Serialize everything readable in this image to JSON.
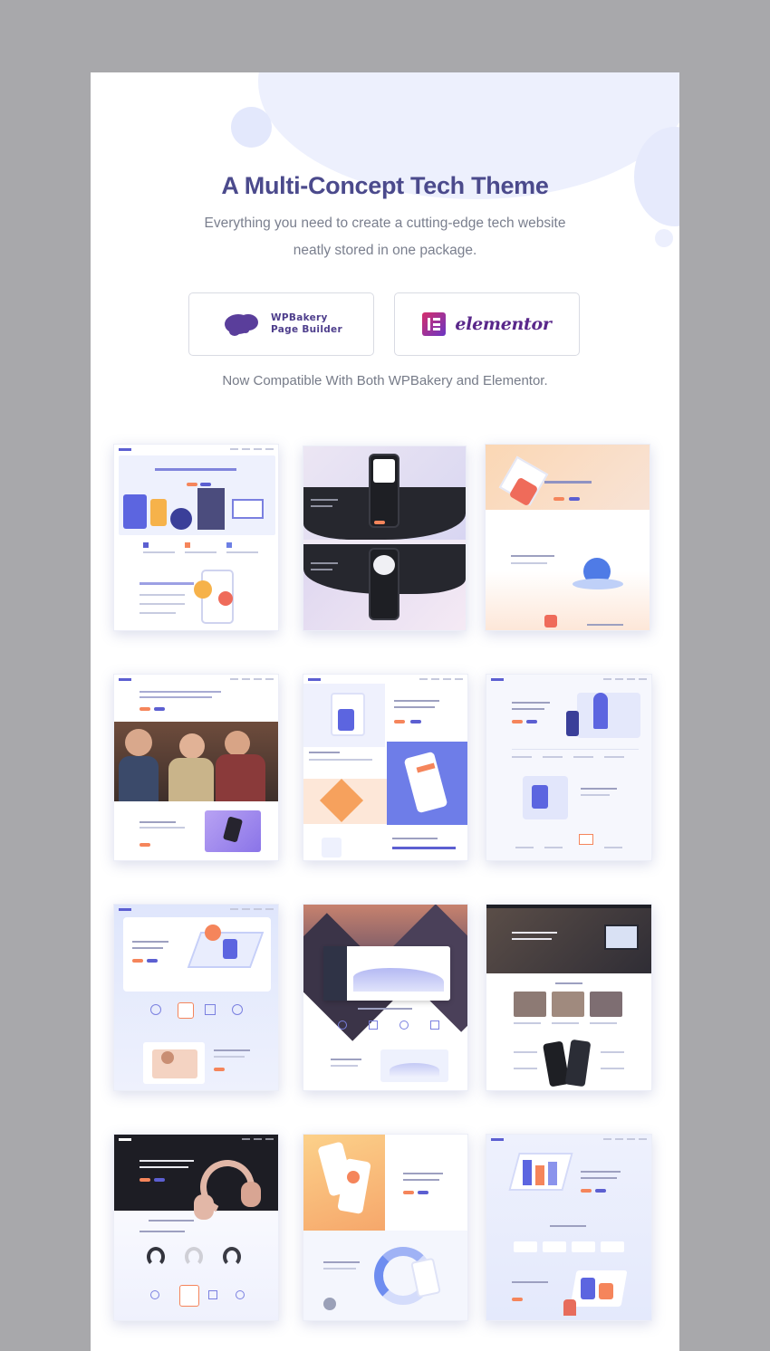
{
  "hero": {
    "title": "A Multi-Concept Tech Theme",
    "subtitle_line1": "Everything you need to create a cutting-edge tech website",
    "subtitle_line2": "neatly stored in one package."
  },
  "builders": {
    "wpbakery_label": "WPBakery\nPage Builder",
    "elementor_label": "elementor"
  },
  "compat_text": "Now Compatible With Both WPBakery and Elementor.",
  "colors": {
    "accent": "#4b4a8c",
    "brand_purple": "#5c5fd1",
    "cta_orange": "#f5855b",
    "elementor_gradient": "#d62e6b"
  },
  "thumbnails": [
    {
      "name": "demo-preview-1",
      "icon": "startup-illustration-icon"
    },
    {
      "name": "demo-preview-2",
      "icon": "phone-mockup-icon"
    },
    {
      "name": "demo-preview-3",
      "icon": "security-illustration-icon"
    },
    {
      "name": "demo-preview-4",
      "icon": "team-photo-icon"
    },
    {
      "name": "demo-preview-5",
      "icon": "app-showcase-icon"
    },
    {
      "name": "demo-preview-6",
      "icon": "rocket-illustration-icon"
    },
    {
      "name": "demo-preview-7",
      "icon": "isometric-app-icon"
    },
    {
      "name": "demo-preview-8",
      "icon": "mountain-dashboard-icon"
    },
    {
      "name": "demo-preview-9",
      "icon": "office-photo-icon"
    },
    {
      "name": "demo-preview-10",
      "icon": "headphones-icon"
    },
    {
      "name": "demo-preview-11",
      "icon": "gradient-phone-icon"
    },
    {
      "name": "demo-preview-12",
      "icon": "workspace-illustration-icon"
    }
  ]
}
